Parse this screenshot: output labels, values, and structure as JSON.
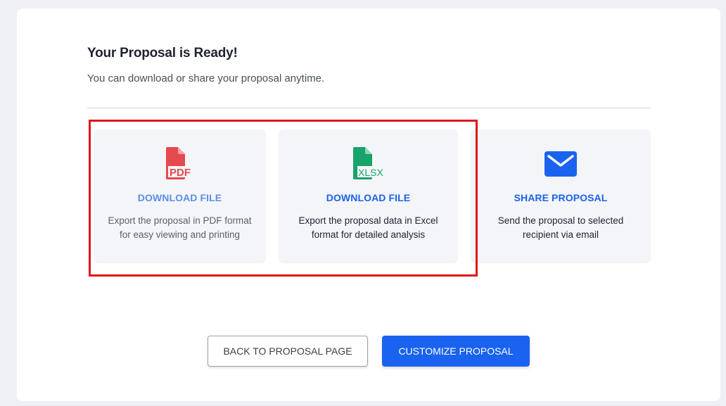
{
  "header": {
    "title": "Your Proposal is Ready!",
    "subtitle": "You can download or share your proposal anytime."
  },
  "cards": [
    {
      "icon": "pdf-file-icon",
      "icon_text": "PDF",
      "icon_color": "#e5484d",
      "label": "DOWNLOAD FILE",
      "description_line1": "Export the proposal in PDF format",
      "description_line2": "for easy viewing and printing"
    },
    {
      "icon": "xlsx-file-icon",
      "icon_text": "XLSX",
      "icon_color": "#18a36b",
      "label": "DOWNLOAD FILE",
      "description_line1": "Export the proposal data in Excel",
      "description_line2": "format for detailed analysis"
    },
    {
      "icon": "envelope-icon",
      "icon_color": "#1a63f0",
      "label": "SHARE PROPOSAL",
      "description_line1": "Send the proposal to selected",
      "description_line2": "recipient via email"
    }
  ],
  "buttons": {
    "back_label": "BACK TO PROPOSAL PAGE",
    "customize_label": "CUSTOMIZE PROPOSAL"
  },
  "colors": {
    "accent": "#1a63f0",
    "highlight_border": "#e0161b"
  }
}
